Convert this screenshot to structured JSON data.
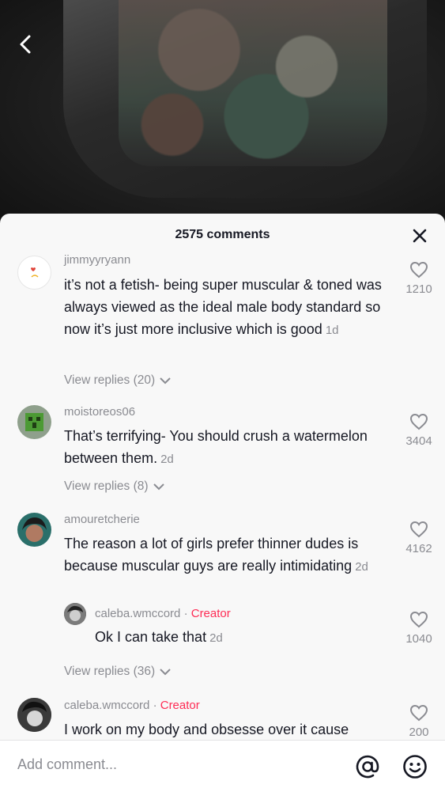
{
  "sheet": {
    "title": "2575 comments"
  },
  "comments": [
    {
      "username": "jimmyyryann",
      "text": "it’s not a fetish- being super muscular & toned was always viewed as the ideal male body standard so now it’s just more inclusive which is good",
      "age": "1d",
      "likes": "1210",
      "view_replies": "View replies (20)",
      "avatar_text": "VOTING is COOL"
    },
    {
      "username": "moistoreos06",
      "text": "That’s terrifying- You should crush a watermelon between them.",
      "age": "2d",
      "likes": "3404",
      "view_replies": "View replies (8)"
    },
    {
      "username": "amouretcherie",
      "text": "The reason a lot of girls prefer thinner dudes is because muscular guys are really intimidating",
      "age": "2d",
      "likes": "4162",
      "view_replies": "View replies (36)",
      "reply": {
        "username": "caleba.wmccord",
        "separator": "·",
        "badge": "Creator",
        "text": "Ok I can take that",
        "age": "2d",
        "likes": "1040"
      }
    },
    {
      "username": "caleba.wmccord",
      "separator": "·",
      "badge": "Creator",
      "text": "I work on my body and obsesse over it cause",
      "likes": "200"
    }
  ],
  "footer": {
    "placeholder": "Add comment..."
  },
  "colors": {
    "creator": "#fe2c55",
    "muted": "#8a8b91",
    "text": "#161823",
    "sheet": "#f8f8f8"
  },
  "icons": [
    "back-arrow-icon",
    "close-icon",
    "heart-icon",
    "chevron-down-icon",
    "at-icon",
    "emoji-icon"
  ]
}
